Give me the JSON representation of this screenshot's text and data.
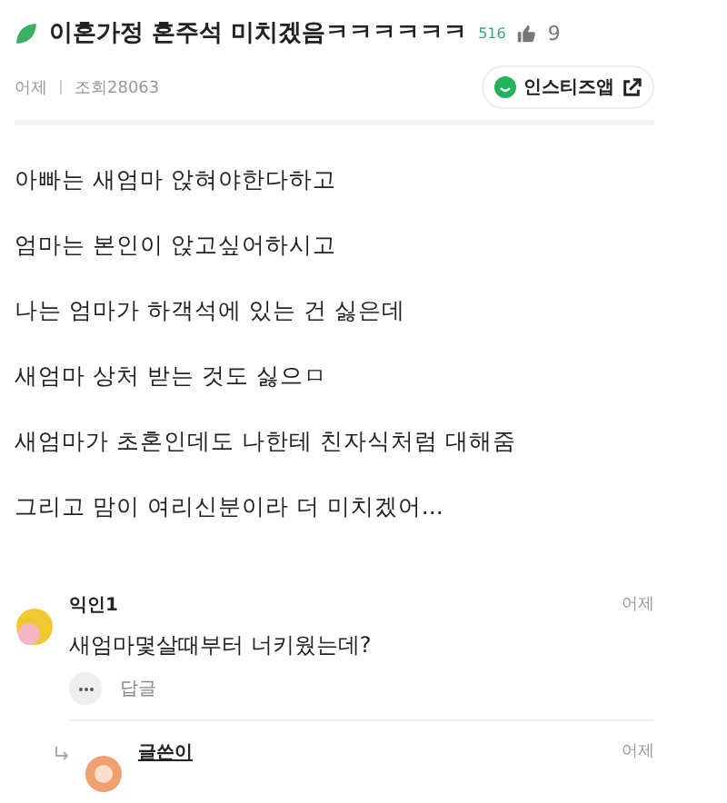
{
  "post": {
    "title": "이혼가정 혼주석 미치겠음ㅋㅋㅋㅋㅋㅋ",
    "small_count": "516",
    "likes": "9",
    "date": "어제",
    "views": "조회28063",
    "app_button": "인스티즈앱"
  },
  "body": [
    "아빠는 새엄마 앉혀야한다하고",
    "엄마는 본인이 앉고싶어하시고",
    "나는 엄마가 하객석에 있는 건 싫은데",
    "새엄마 상처 받는 것도 싫으ㅁ",
    "새엄마가 초혼인데도 나한테 친자식처럼 대해줌",
    "그리고 맘이 여리신분이라 더 미치겠어..."
  ],
  "comments": [
    {
      "kind": "comment",
      "author": "익인1",
      "date": "어제",
      "text": "새엄마몇살때부터 너키웠는데?",
      "reply_label": "답글",
      "color": "#f2c830"
    },
    {
      "kind": "reply",
      "author": "글쓴이",
      "date": "어제",
      "color": "#f0a070"
    }
  ]
}
